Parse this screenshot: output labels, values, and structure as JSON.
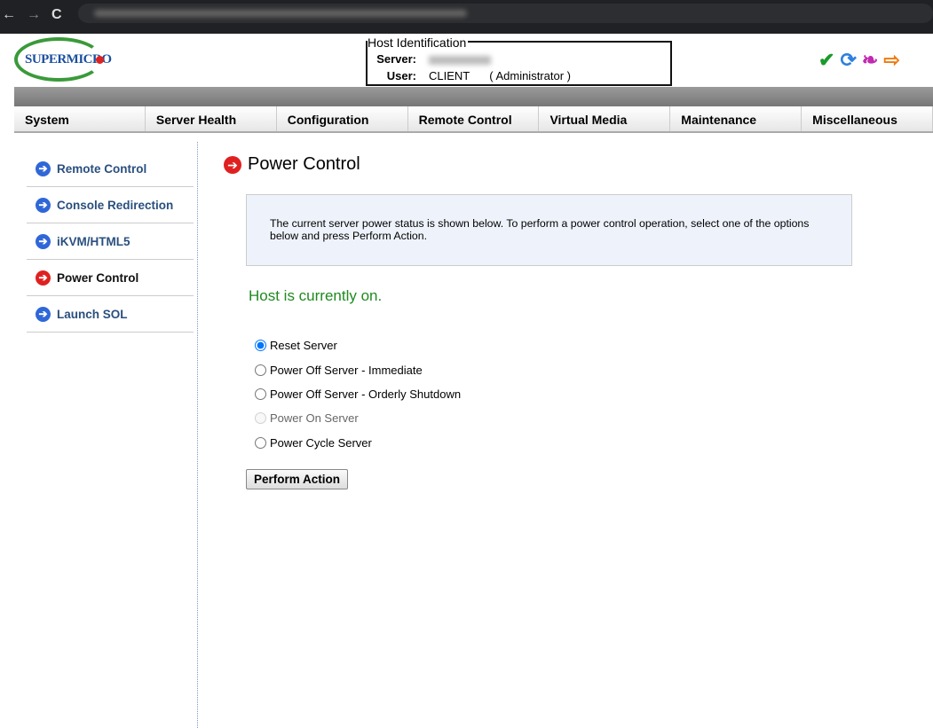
{
  "browser": {
    "back": "←",
    "forward": "→",
    "reload": "C"
  },
  "logo": "SUPERMICRO",
  "host": {
    "legend": "Host Identification",
    "server_label": "Server:",
    "user_label": "User:",
    "user": "CLIENT",
    "role": "( Administrator )"
  },
  "menu": [
    "System",
    "Server Health",
    "Configuration",
    "Remote Control",
    "Virtual Media",
    "Maintenance",
    "Miscellaneous"
  ],
  "sidebar": [
    {
      "label": "Remote Control"
    },
    {
      "label": "Console Redirection"
    },
    {
      "label": "iKVM/HTML5"
    },
    {
      "label": "Power Control",
      "active": true
    },
    {
      "label": "Launch SOL"
    }
  ],
  "page": {
    "title": "Power Control",
    "info": "The current server power status is shown below. To perform a power control operation, select one of the options below and press Perform Action.",
    "status": "Host is currently on.",
    "status_color": "#1f8a1f",
    "options": [
      {
        "label": "Reset Server",
        "checked": true
      },
      {
        "label": "Power Off Server - Immediate"
      },
      {
        "label": "Power Off Server - Orderly Shutdown"
      },
      {
        "label": "Power On Server",
        "disabled": true
      },
      {
        "label": "Power Cycle Server"
      }
    ],
    "button": "Perform Action"
  }
}
